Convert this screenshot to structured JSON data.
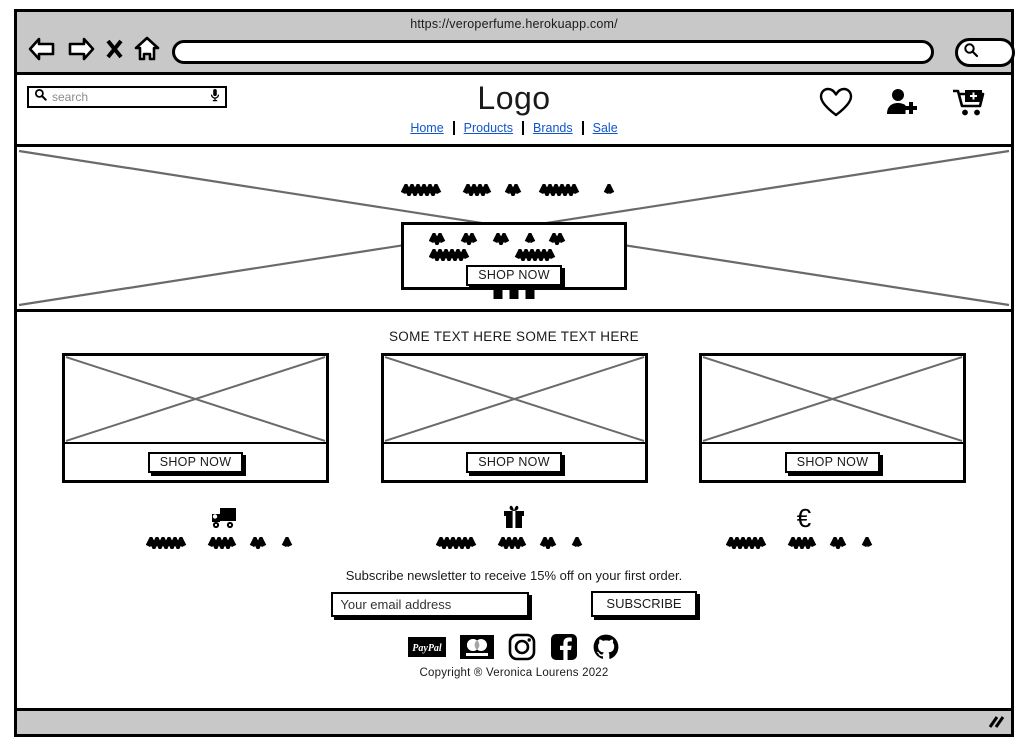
{
  "browser": {
    "url": "https://veroperfume.herokuapp.com/",
    "address_value": "",
    "nav": {
      "back": "back-arrow",
      "forward": "forward-arrow",
      "stop": "stop-x",
      "home": "home"
    },
    "go_button": "search-go"
  },
  "header": {
    "search": {
      "placeholder": "search",
      "icon": "search-icon",
      "mic_icon": "microphone-icon"
    },
    "logo": "Logo",
    "nav_links": [
      "Home",
      "Products",
      "Brands",
      "Sale"
    ],
    "icons": [
      {
        "name": "wishlist-heart-icon"
      },
      {
        "name": "account-add-user-icon"
      },
      {
        "name": "cart-add-icon"
      }
    ]
  },
  "hero": {
    "title_placeholder": "scribble-text-line",
    "card": {
      "line1": "scribble-text-line",
      "line2": "scribble-text-line",
      "button": "SHOP NOW"
    },
    "carousel_dots": 3
  },
  "main": {
    "section_title": "SOME TEXT HERE SOME TEXT HERE",
    "cards": [
      {
        "image": "image-placeholder",
        "button": "SHOP NOW"
      },
      {
        "image": "image-placeholder",
        "button": "SHOP NOW"
      },
      {
        "image": "image-placeholder",
        "button": "SHOP NOW"
      }
    ],
    "services": [
      {
        "icon": "delivery-truck-icon",
        "text": "scribble-text-line"
      },
      {
        "icon": "gift-icon",
        "text": "scribble-text-line"
      },
      {
        "icon": "euro-icon",
        "symbol": "€",
        "text": "scribble-text-line"
      }
    ]
  },
  "newsletter": {
    "message": "Subscribe newsletter to receive 15% off on your first order.",
    "email_placeholder": "Your email address",
    "email_value": "",
    "submit_label": "SUBSCRIBE"
  },
  "footer": {
    "payment_icons": [
      "paypal-icon",
      "mastercard-icon"
    ],
    "social_icons": [
      "instagram-icon",
      "facebook-icon",
      "github-icon"
    ],
    "copyright": "Copyright ® Veronica Lourens 2022"
  },
  "status_bar": {
    "resize_handle": "resize-grip"
  },
  "colors": {
    "chrome": "#c8c8c8",
    "link": "#1155cc",
    "stroke": "#000000",
    "placeholder": "#8c8c8c"
  }
}
